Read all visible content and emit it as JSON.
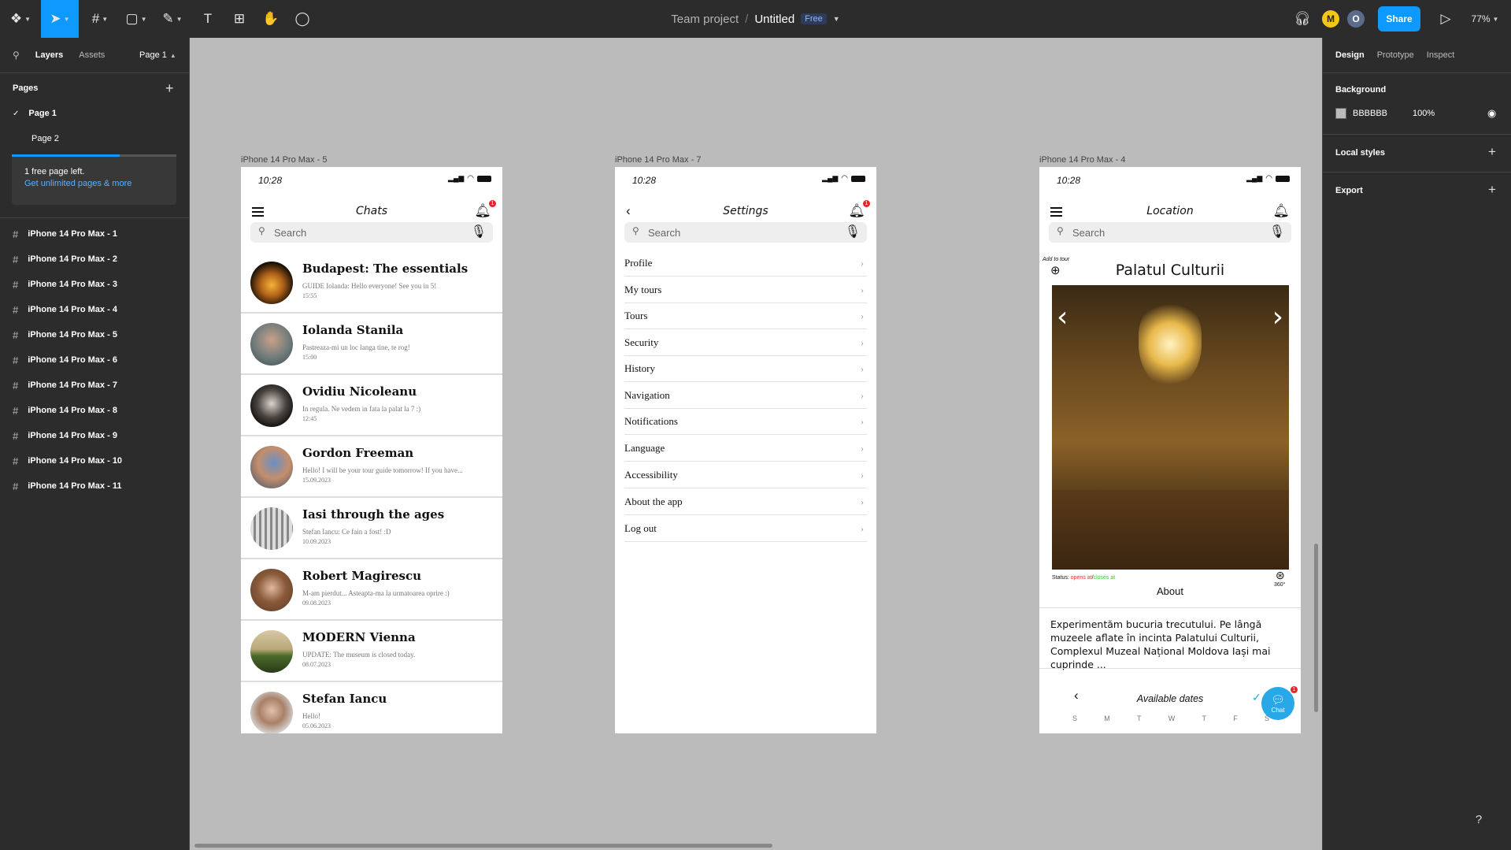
{
  "toolbar": {
    "team": "Team project",
    "sep": "/",
    "file": "Untitled",
    "plan": "Free",
    "share": "Share",
    "zoom": "77%",
    "avatar_m": "M",
    "avatar_o": "O",
    "avatar_m_color": "#f5c518",
    "avatar_o_color": "#5b6c8a",
    "accent": "#0d99ff"
  },
  "left": {
    "tab_layers": "Layers",
    "tab_assets": "Assets",
    "page_selector": "Page 1",
    "pages_heading": "Pages",
    "pages": [
      "Page 1",
      "Page 2"
    ],
    "upsell_text": "1 free page left.",
    "upsell_link": "Get unlimited pages & more",
    "layers": [
      "iPhone 14 Pro Max - 1",
      "iPhone 14 Pro Max - 2",
      "iPhone 14 Pro Max - 3",
      "iPhone 14 Pro Max - 4",
      "iPhone 14 Pro Max - 5",
      "iPhone 14 Pro Max - 6",
      "iPhone 14 Pro Max - 7",
      "iPhone 14 Pro Max - 8",
      "iPhone 14 Pro Max - 9",
      "iPhone 14 Pro Max - 10",
      "iPhone 14 Pro Max - 11"
    ]
  },
  "right": {
    "tab_design": "Design",
    "tab_prototype": "Prototype",
    "tab_inspect": "Inspect",
    "background_heading": "Background",
    "bg_hex": "BBBBBB",
    "bg_opacity": "100%",
    "local_styles": "Local styles",
    "export": "Export"
  },
  "frames": {
    "chats_label": "iPhone 14 Pro Max - 5",
    "settings_label": "iPhone 14 Pro Max - 7",
    "location_label": "iPhone 14 Pro Max - 4"
  },
  "phone": {
    "time": "10:28",
    "search": "Search",
    "badge": "1"
  },
  "chats": {
    "title": "Chats",
    "items": [
      {
        "name": "Budapest: The essentials",
        "msg": "GUIDE Iolanda: Hello everyone! See you in 5!",
        "date": "15:55"
      },
      {
        "name": "Iolanda Stanila",
        "msg": "Pastreaza-mi un loc langa tine, te rog!",
        "date": "15:00"
      },
      {
        "name": "Ovidiu Nicoleanu",
        "msg": "In regula. Ne vedem in fata la palat la 7 :)",
        "date": "12:45"
      },
      {
        "name": "Gordon Freeman",
        "msg": "Hello! I will be your tour guide tomorrow! If you have...",
        "date": "15.09.2023"
      },
      {
        "name": "Iasi through the ages",
        "msg": "Stefan Iancu: Ce fain a fost! :D",
        "date": "10.09.2023"
      },
      {
        "name": "Robert Magirescu",
        "msg": "M-am pierdut... Asteapta-ma la urmatoarea oprire :)",
        "date": "09.08.2023"
      },
      {
        "name": "MODERN Vienna",
        "msg": "UPDATE: The museum is closed today.",
        "date": "08.07.2023"
      },
      {
        "name": "Stefan Iancu",
        "msg": "Hello!",
        "date": "05.06.2023"
      }
    ]
  },
  "settings": {
    "title": "Settings",
    "items": [
      "Profile",
      "My tours",
      "Tours",
      "Security",
      "History",
      "Navigation",
      "Notifications",
      "Language",
      "Accessibility",
      "About the app",
      "Log out"
    ]
  },
  "location": {
    "title": "Location",
    "add_to_tour": "Add to tour",
    "place": "Palatul Culturii",
    "status_label": "Status:",
    "opens": "opens at",
    "slash": "/",
    "closes": "closes at",
    "deg": "360°",
    "about": "About",
    "description": "Experimentăm bucuria trecutului. Pe lângă muzeele aflate în incinta Palatului Culturii, Complexul Muzeal Național Moldova Iași mai cuprinde ...",
    "available_dates": "Available dates",
    "weekdays": [
      "S",
      "M",
      "T",
      "W",
      "T",
      "F",
      "S"
    ],
    "chat": "Chat",
    "chat_badge": "1"
  }
}
